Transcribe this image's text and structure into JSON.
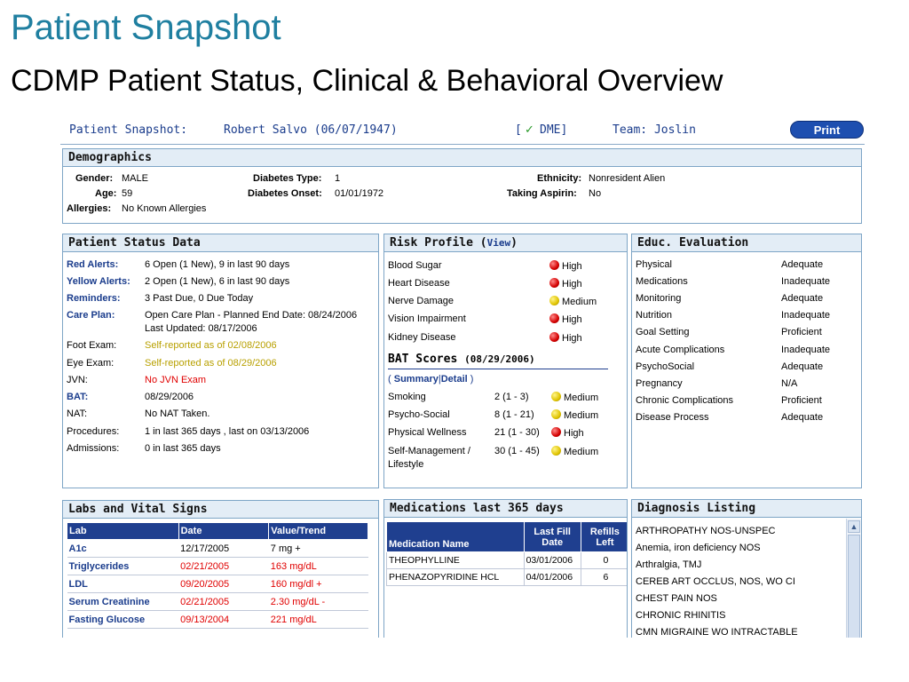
{
  "slide": {
    "title": "Patient Snapshot",
    "subtitle": "CDMP Patient Status, Clinical & Behavioral Overview"
  },
  "header": {
    "label": "Patient Snapshot:",
    "patient": "Robert Salvo (06/07/1947)",
    "dme_open": "[",
    "dme_check": "✓",
    "dme_label": "DME]",
    "team": "Team: Joslin",
    "print_label": "Print"
  },
  "demographics": {
    "title": "Demographics",
    "gender_label": "Gender:",
    "gender": "MALE",
    "age_label": "Age:",
    "age": "59",
    "allergies_label": "Allergies:",
    "allergies": "No Known Allergies",
    "dtype_label": "Diabetes Type:",
    "dtype": "1",
    "donset_label": "Diabetes Onset:",
    "donset": "01/01/1972",
    "ethnicity_label": "Ethnicity:",
    "ethnicity": "Nonresident Alien",
    "aspirin_label": "Taking Aspirin:",
    "aspirin": "No"
  },
  "status": {
    "title": "Patient Status Data",
    "rows": [
      {
        "label": "Red Alerts:",
        "value": "6 Open (1 New), 9 in last 90 days"
      },
      {
        "label": "Yellow Alerts:",
        "value": "2 Open (1 New), 6 in last 90 days"
      },
      {
        "label": "Reminders:",
        "value": "3 Past Due, 0 Due Today"
      },
      {
        "label": "Care Plan:",
        "value": "Open Care Plan - Planned End Date: 08/24/2006",
        "value2": "Last Updated: 08/17/2006"
      },
      {
        "label": "Foot Exam:",
        "value": "Self-reported as of 02/08/2006"
      },
      {
        "label": "Eye Exam:",
        "value": "Self-reported as of 08/29/2006"
      },
      {
        "label": "JVN:",
        "value": "No JVN Exam"
      },
      {
        "label": "BAT:",
        "value": "08/29/2006"
      },
      {
        "label": "NAT:",
        "value": "No NAT Taken."
      },
      {
        "label": "Procedures:",
        "value": "1 in last 365 days , last on 03/13/2006"
      },
      {
        "label": "Admissions:",
        "value": "0 in last 365 days"
      }
    ]
  },
  "risk": {
    "title": "Risk Profile (",
    "view_link": "View",
    "title_close": ")",
    "rows": [
      {
        "name": "Blood Sugar",
        "level": "High"
      },
      {
        "name": "Heart Disease",
        "level": "High"
      },
      {
        "name": "Nerve Damage",
        "level": "Medium"
      },
      {
        "name": "Vision Impairment",
        "level": "High"
      },
      {
        "name": "Kidney Disease",
        "level": "High"
      }
    ]
  },
  "bat": {
    "title": "BAT Scores",
    "date": "(08/29/2006)",
    "open": "(",
    "summary": "Summary",
    "sep": "|",
    "detail": "Detail",
    "close": ")",
    "rows": [
      {
        "name": "Smoking",
        "score": "2 (1 - 3)",
        "level": "Medium"
      },
      {
        "name": "Psycho-Social",
        "score": "8 (1 - 21)",
        "level": "Medium"
      },
      {
        "name": "Physical Wellness",
        "score": "21 (1 - 30)",
        "level": "High"
      },
      {
        "name": "Self-Management /",
        "name2": "Lifestyle",
        "score": "30 (1 - 45)",
        "level": "Medium"
      }
    ]
  },
  "educ": {
    "title": "Educ. Evaluation",
    "rows": [
      {
        "topic": "Physical",
        "rating": "Adequate"
      },
      {
        "topic": "Medications",
        "rating": "Inadequate"
      },
      {
        "topic": "Monitoring",
        "rating": "Adequate"
      },
      {
        "topic": "Nutrition",
        "rating": "Inadequate"
      },
      {
        "topic": "Goal Setting",
        "rating": "Proficient"
      },
      {
        "topic": "Acute Complications",
        "rating": "Inadequate"
      },
      {
        "topic": "PsychoSocial",
        "rating": "Adequate"
      },
      {
        "topic": "Pregnancy",
        "rating": "N/A"
      },
      {
        "topic": "Chronic Complications",
        "rating": "Proficient"
      },
      {
        "topic": "Disease Process",
        "rating": "Adequate"
      }
    ]
  },
  "labs": {
    "title": "Labs and Vital Signs",
    "columns": [
      "Lab",
      "Date",
      "Value/Trend"
    ],
    "rows": [
      {
        "lab": "A1c",
        "date": "12/17/2005",
        "value": "7 mg +"
      },
      {
        "lab": "Triglycerides",
        "date": "02/21/2005",
        "value": "163 mg/dL"
      },
      {
        "lab": "LDL",
        "date": "09/20/2005",
        "value": "160 mg/dl +"
      },
      {
        "lab": "Serum Creatinine",
        "date": "02/21/2005",
        "value": "2.30 mg/dL -"
      },
      {
        "lab": "Fasting Glucose",
        "date": "09/13/2004",
        "value": "221 mg/dL"
      }
    ]
  },
  "meds": {
    "title": "Medications last 365 days",
    "columns": [
      "Medication Name",
      "Last Fill",
      "Date",
      "Refills",
      "Left"
    ],
    "rows": [
      {
        "name": "THEOPHYLLINE",
        "date": "03/01/2006",
        "refills": "0"
      },
      {
        "name": "PHENAZOPYRIDINE HCL",
        "date": "04/01/2006",
        "refills": "6"
      }
    ]
  },
  "diagnosis": {
    "title": "Diagnosis Listing",
    "scroll_up": "▲",
    "rows": [
      "ARTHROPATHY NOS-UNSPEC",
      "Anemia, iron deficiency NOS",
      "Arthralgia, TMJ",
      "CEREB ART OCCLUS, NOS, WO CI",
      "CHEST PAIN NOS",
      "CHRONIC RHINITIS",
      "CMN MIGRAINE WO INTRACTABLE"
    ]
  },
  "colors": {
    "title_teal": "#1f7fa0",
    "link_blue": "#1a3c8c",
    "header_navy": "#1f3f8f",
    "alert_red": "#e00000",
    "alert_yellow": "#b8a000"
  }
}
